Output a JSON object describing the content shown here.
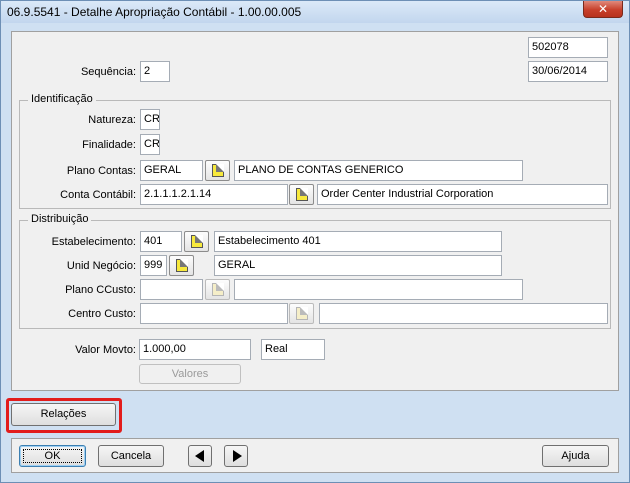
{
  "window": {
    "title": "06.9.5541 - Detalhe Apropriação Contábil - 1.00.00.005",
    "close_label": "✕"
  },
  "header": {
    "id_value": "502078",
    "sequence_label": "Sequência:",
    "sequence_value": "2",
    "date_value": "30/06/2014"
  },
  "identificacao": {
    "title": "Identificação",
    "natureza_label": "Natureza:",
    "natureza_value": "CR",
    "finalidade_label": "Finalidade:",
    "finalidade_value": "CR",
    "plano_contas_label": "Plano Contas:",
    "plano_contas_code": "GERAL",
    "plano_contas_desc": "PLANO DE CONTAS GENERICO",
    "conta_contabil_label": "Conta Contábil:",
    "conta_contabil_code": "2.1.1.1.2.1.14",
    "conta_contabil_desc": "Order Center Industrial Corporation"
  },
  "distribuicao": {
    "title": "Distribuição",
    "estabelecimento_label": "Estabelecimento:",
    "estabelecimento_code": "401",
    "estabelecimento_desc": "Estabelecimento 401",
    "unid_negocio_label": "Unid Negócio:",
    "unid_negocio_code": "999",
    "unid_negocio_desc": "GERAL",
    "plano_ccusto_label": "Plano CCusto:",
    "plano_ccusto_code": "",
    "plano_ccusto_desc": "",
    "centro_custo_label": "Centro Custo:",
    "centro_custo_code": "",
    "centro_custo_desc": ""
  },
  "valor": {
    "label": "Valor Movto:",
    "value": "1.000,00",
    "currency": "Real",
    "valores_button": "Valores"
  },
  "actions": {
    "relacoes_button": "Relações",
    "ok_button": "OK",
    "cancel_button": "Cancela",
    "help_button": "Ajuda"
  },
  "colors": {
    "highlight": "#e21c1c",
    "zoom_icon": "#f7e93c"
  }
}
